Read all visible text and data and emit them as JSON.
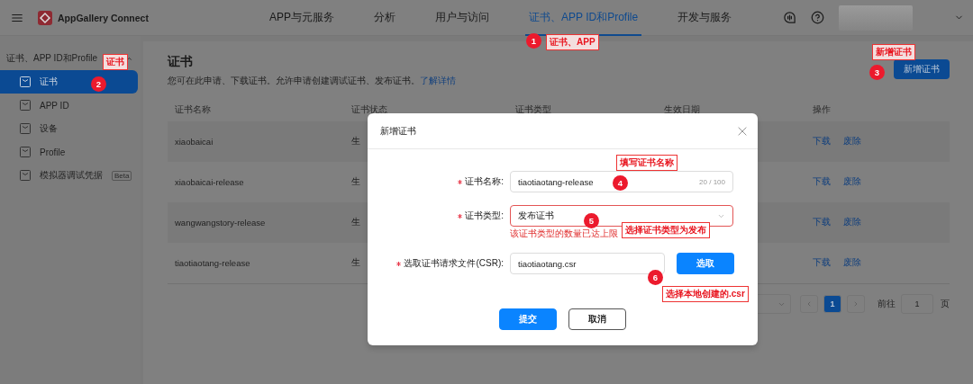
{
  "header": {
    "logo_text": "AppGallery Connect",
    "nav": [
      {
        "label": "APP与元服务",
        "selected": false
      },
      {
        "label": "分析",
        "selected": false
      },
      {
        "label": "用户与访问",
        "selected": false
      },
      {
        "label": "证书、APP ID和Profile",
        "selected": true
      },
      {
        "label": "开发与服务",
        "selected": false
      }
    ]
  },
  "sidebar": {
    "group": {
      "label": "证书、APP ID和Profile",
      "expanded": true
    },
    "items": [
      {
        "label": "证书",
        "selected": true
      },
      {
        "label": "APP ID",
        "selected": false
      },
      {
        "label": "设备",
        "selected": false
      },
      {
        "label": "Profile",
        "selected": false
      },
      {
        "label": "模拟器调试凭据",
        "selected": false,
        "badge": "Beta"
      }
    ]
  },
  "page": {
    "title": "证书",
    "description": "您可在此申请、下载证书。允许申请创建调试证书、发布证书。",
    "link": "了解详情",
    "add_button": "新增证书"
  },
  "table": {
    "columns": [
      "证书名称",
      "证书状态",
      "证书类型",
      "生效日期",
      "操作"
    ],
    "rows": [
      {
        "cells": [
          "xiaobaicai",
          "生"
        ],
        "actions": [
          "下载",
          "废除"
        ]
      },
      {
        "cells": [
          "xiaobaicai-release",
          "生"
        ],
        "actions": [
          "下载",
          "废除"
        ]
      },
      {
        "cells": [
          "wangwangstory-release",
          "生"
        ],
        "actions": [
          "下载",
          "废除"
        ]
      },
      {
        "cells": [
          "tiaotiaotang-release",
          "生"
        ],
        "actions": [
          "下载",
          "废除"
        ]
      }
    ]
  },
  "pagination": {
    "pages": [
      {
        "label": "1",
        "selected": true
      }
    ],
    "goto_label": "前往",
    "goto_value": "1",
    "page_suffix": "页"
  },
  "dialog": {
    "title": "新增证书",
    "fields": [
      {
        "kind": "text",
        "label": "证书名称:",
        "required": true,
        "value": "tiaotiaotang-release",
        "counter": "20 / 100"
      },
      {
        "kind": "select",
        "label": "证书类型:",
        "required": true,
        "value": "发布证书",
        "error": "该证书类型的数量已达上限"
      },
      {
        "kind": "file",
        "label": "选取证书请求文件(CSR):",
        "required": true,
        "value": "tiaotiaotang.csr",
        "button": "选取"
      }
    ],
    "buttons": [
      {
        "label": "提交",
        "kind": "primary"
      },
      {
        "label": "取消",
        "kind": "secondary"
      }
    ]
  },
  "annotations": [
    {
      "number": "1",
      "label": "证书、APP"
    },
    {
      "number": "2",
      "label": "证书"
    },
    {
      "number": "3",
      "label": "新增证书"
    },
    {
      "number": "4",
      "label": "填写证书名称"
    },
    {
      "number": "5",
      "label": "选择证书类型为发布"
    },
    {
      "number": "6",
      "label": "选择本地创建的.csr"
    }
  ]
}
